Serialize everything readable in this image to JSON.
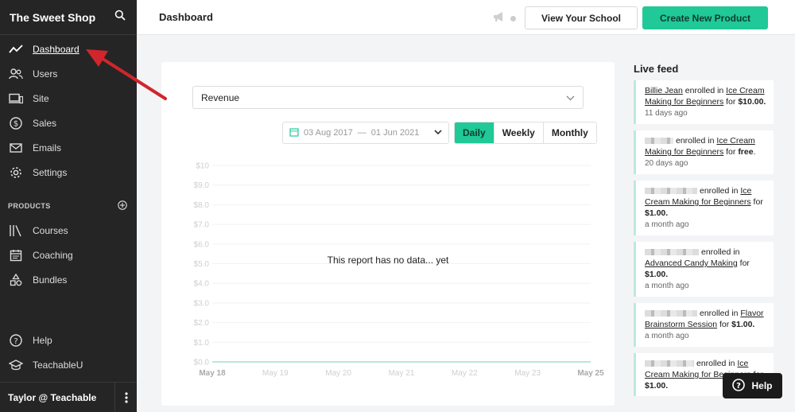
{
  "sidebar": {
    "brand": "The Sweet Shop",
    "items": [
      {
        "label": "Dashboard",
        "icon": "trend-line-icon"
      },
      {
        "label": "Users",
        "icon": "users-icon"
      },
      {
        "label": "Site",
        "icon": "devices-icon"
      },
      {
        "label": "Sales",
        "icon": "dollar-circle-icon"
      },
      {
        "label": "Emails",
        "icon": "mail-icon"
      },
      {
        "label": "Settings",
        "icon": "gear-icon"
      }
    ],
    "products_section": "PRODUCTS",
    "product_items": [
      {
        "label": "Courses",
        "icon": "books-icon"
      },
      {
        "label": "Coaching",
        "icon": "calendar-icon"
      },
      {
        "label": "Bundles",
        "icon": "shapes-icon"
      }
    ],
    "bottom_items": [
      {
        "label": "Help",
        "icon": "question-circle-icon"
      },
      {
        "label": "TeachableU",
        "icon": "graduation-cap-icon"
      }
    ],
    "user": "Taylor @ Teachable"
  },
  "topbar": {
    "title": "Dashboard",
    "view_school": "View Your School",
    "create_product": "Create New Product"
  },
  "report": {
    "metric": "Revenue",
    "date_start": "03 Aug 2017",
    "date_sep": "—",
    "date_end": "01 Jun 2021",
    "granularity": [
      "Daily",
      "Weekly",
      "Monthly"
    ],
    "active_granularity": "Daily",
    "empty_message": "This report has no data... yet"
  },
  "chart_data": {
    "type": "line",
    "categories": [
      "May 18",
      "May 19",
      "May 20",
      "May 21",
      "May 22",
      "May 23",
      "May 25"
    ],
    "y_ticks": [
      "$10",
      "$9.0",
      "$8.0",
      "$7.0",
      "$6.0",
      "$5.0",
      "$4.0",
      "$3.0",
      "$2.0",
      "$1.0",
      "$0.0"
    ],
    "ylim": [
      0,
      10
    ],
    "series": [
      {
        "values": [
          0,
          0,
          0,
          0,
          0,
          0,
          0
        ]
      }
    ]
  },
  "feed": {
    "title": "Live feed",
    "items": [
      {
        "name": "Billie Jean",
        "text": " enrolled in ",
        "course": "Ice Cream Making for Beginners",
        "prep": " for ",
        "amount": "$10.00.",
        "ago": "11 days ago",
        "blurred": false
      },
      {
        "name": "",
        "text": "enrolled in ",
        "course": "Ice Cream Making for Beginners",
        "prep": " for ",
        "amount": "free",
        "suffix": ".",
        "ago": "20 days ago",
        "blurred": true
      },
      {
        "name": "",
        "text": "enrolled in ",
        "course": "Ice Cream Making for Beginners",
        "prep": " for ",
        "amount": "$1.00.",
        "ago": "a month ago",
        "blurred": true
      },
      {
        "name": "",
        "text": "enrolled in ",
        "course": "Advanced Candy Making",
        "prep": " for ",
        "amount": "$1.00.",
        "ago": "a month ago",
        "blurred": true
      },
      {
        "name": "",
        "text": "enrolled in ",
        "course": "Flavor Brainstorm Session",
        "prep": " for ",
        "amount": "$1.00.",
        "ago": "a month ago",
        "blurred": true
      },
      {
        "name": "",
        "text": "enrolled in ",
        "course": "Ice Cream Making for Beginners",
        "prep": " for ",
        "amount": "$1.00.",
        "ago": "",
        "blurred": true
      }
    ]
  },
  "help_button": "Help",
  "colors": {
    "accent": "#20c997",
    "sidebar": "#252525",
    "annotation_arrow": "#d0262c"
  }
}
